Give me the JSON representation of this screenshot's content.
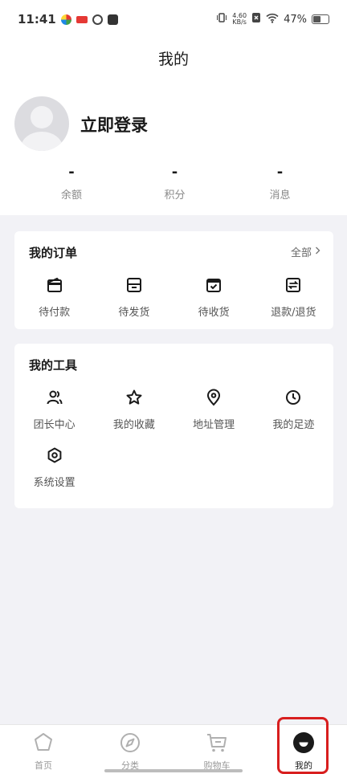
{
  "status_bar": {
    "time": "11:41",
    "net_speed_value": "4.60",
    "net_speed_unit": "KB/s",
    "battery_percent": "47%",
    "battery_level": 0.47
  },
  "nav": {
    "title": "我的"
  },
  "profile": {
    "login_text": "立即登录",
    "stats": [
      {
        "value": "-",
        "label": "余额"
      },
      {
        "value": "-",
        "label": "积分"
      },
      {
        "value": "-",
        "label": "消息"
      }
    ]
  },
  "orders": {
    "title": "我的订单",
    "more_label": "全部",
    "items": [
      {
        "label": "待付款",
        "icon": "wallet-icon"
      },
      {
        "label": "待发货",
        "icon": "package-icon"
      },
      {
        "label": "待收货",
        "icon": "inbox-icon"
      },
      {
        "label": "退款/退货",
        "icon": "refund-icon"
      }
    ]
  },
  "tools": {
    "title": "我的工具",
    "items": [
      {
        "label": "团长中心",
        "icon": "users-icon"
      },
      {
        "label": "我的收藏",
        "icon": "star-icon"
      },
      {
        "label": "地址管理",
        "icon": "location-pin-icon"
      },
      {
        "label": "我的足迹",
        "icon": "clock-icon"
      },
      {
        "label": "系统设置",
        "icon": "settings-icon"
      }
    ]
  },
  "tab_bar": {
    "items": [
      {
        "label": "首页",
        "icon": "home-icon",
        "active": false
      },
      {
        "label": "分类",
        "icon": "compass-icon",
        "active": false
      },
      {
        "label": "购物车",
        "icon": "cart-icon",
        "active": false
      },
      {
        "label": "我的",
        "icon": "profile-smile-icon",
        "active": true
      }
    ]
  },
  "colors": {
    "highlight": "#d81e1e",
    "background": "#f2f2f6"
  }
}
